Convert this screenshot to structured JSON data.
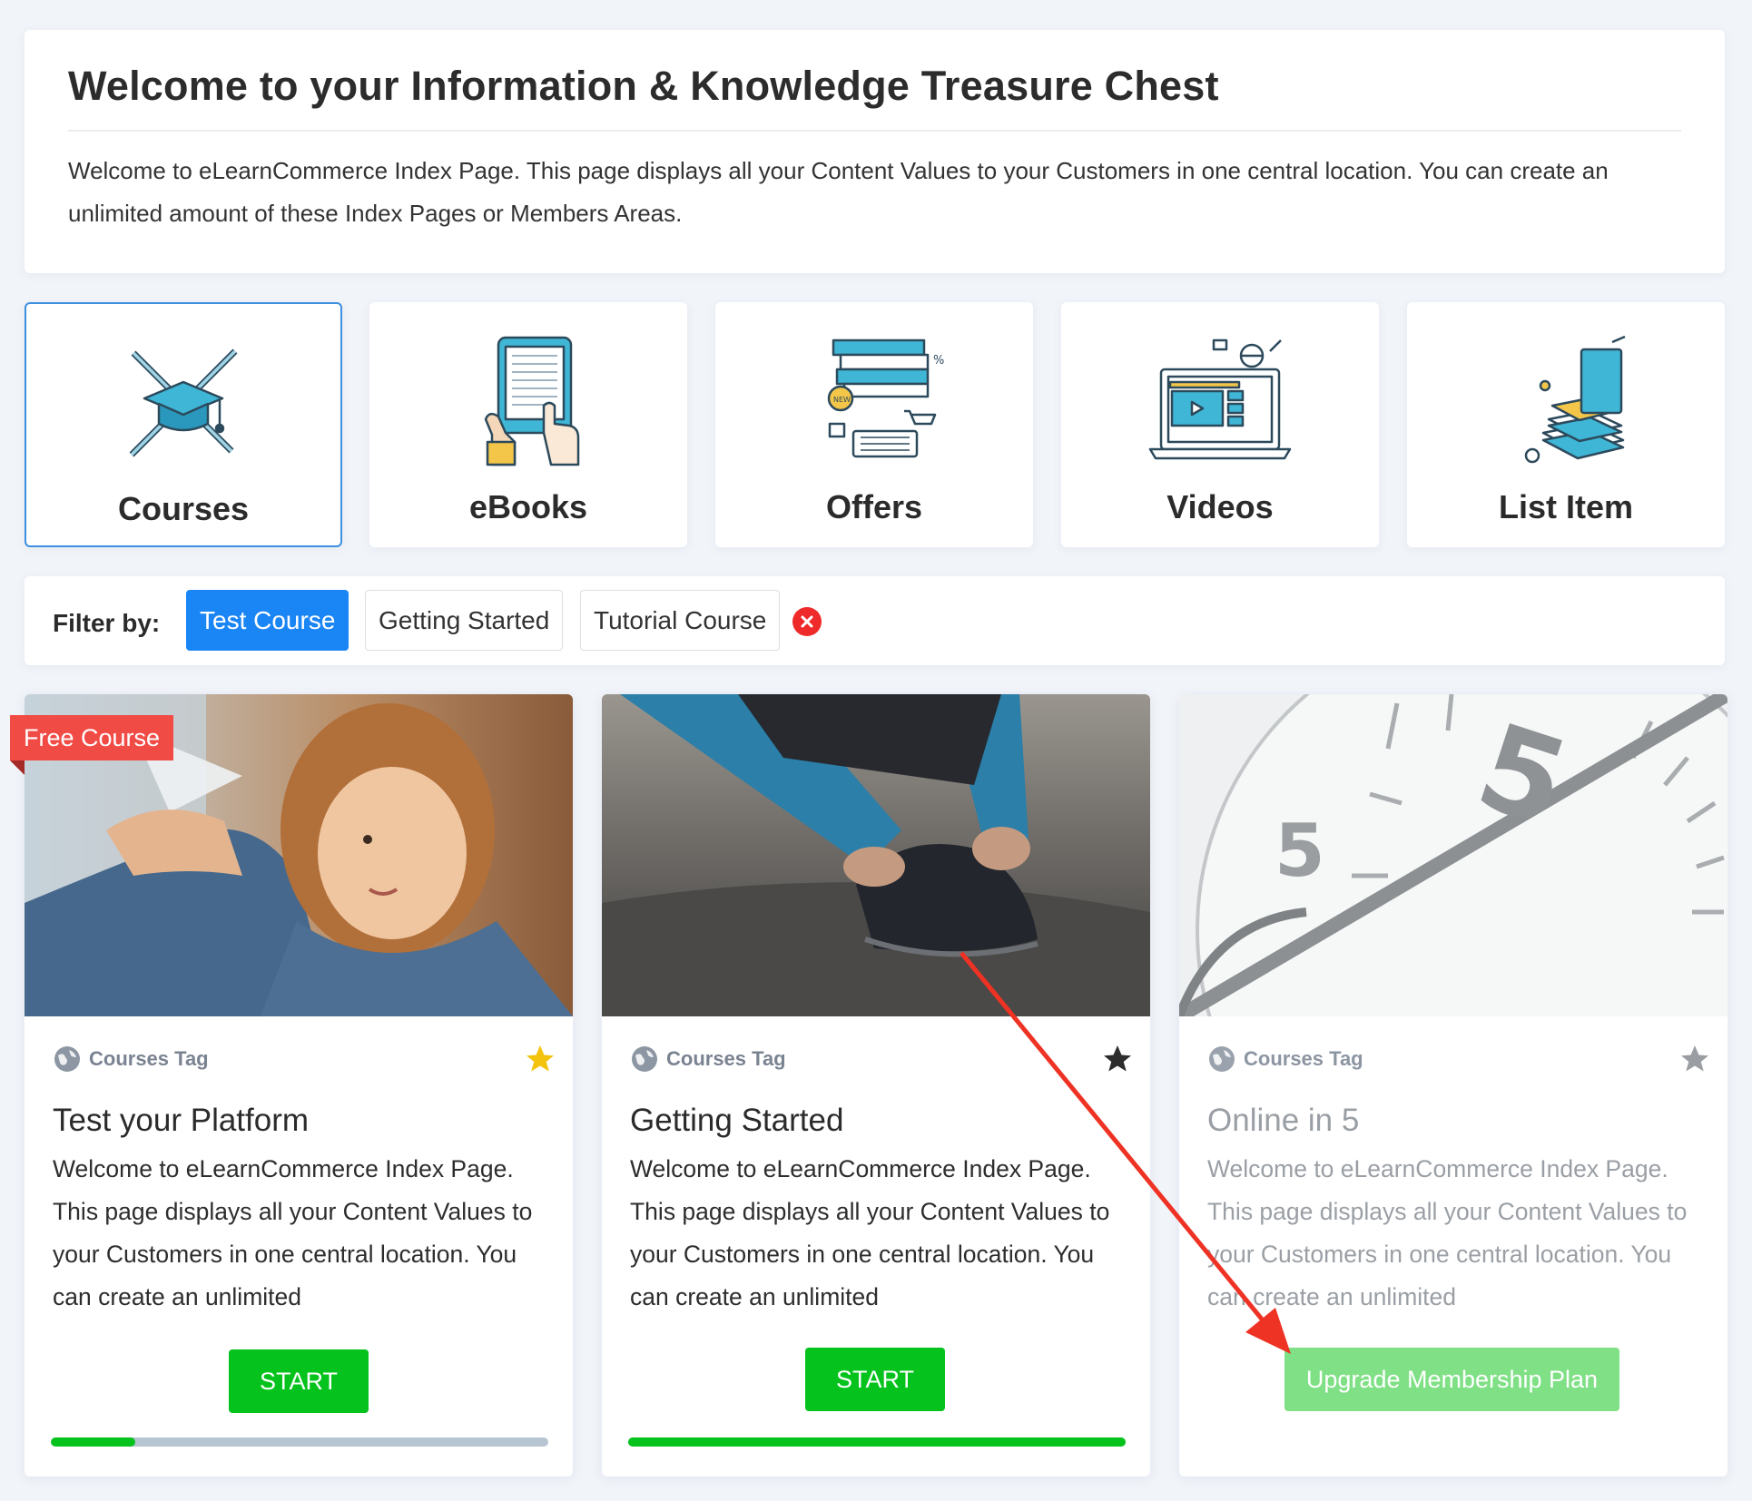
{
  "welcome": {
    "title": "Welcome to your Information & Knowledge Treasure Chest",
    "text": "Welcome to eLearnCommerce Index Page. This page displays all your Content Values to your Customers in one central location. You can create an unlimited amount of these Index Pages or Members Areas."
  },
  "categories": [
    {
      "label": "Courses",
      "icon": "graduation-cap-icon",
      "active": true
    },
    {
      "label": "eBooks",
      "icon": "tablet-ebook-icon",
      "active": false
    },
    {
      "label": "Offers",
      "icon": "books-cart-icon",
      "active": false
    },
    {
      "label": "Videos",
      "icon": "laptop-video-icon",
      "active": false
    },
    {
      "label": "List Item",
      "icon": "book-stack-icon",
      "active": false
    }
  ],
  "filter": {
    "label": "Filter by:",
    "chips": [
      "Test Course",
      "Getting Started",
      "Tutorial Course"
    ],
    "active_chip": "Test Course"
  },
  "cards": [
    {
      "ribbon": "Free Course",
      "tag": "Courses Tag",
      "title": "Test your Platform",
      "description": "Welcome to eLearnCommerce Index Page. This page displays all your Content Values to your Customers in one central location. You can create an unlimited",
      "button": "START",
      "favorite": "gold",
      "progress": 0.17,
      "locked": false
    },
    {
      "tag": "Courses Tag",
      "title": "Getting Started",
      "description": "Welcome to eLearnCommerce Index Page. This page displays all your Content Values to your Customers in one central location. You can create an unlimited",
      "button": "START",
      "favorite": "dark",
      "progress": 1.0,
      "locked": false
    },
    {
      "tag": "Courses Tag",
      "title": "Online in 5",
      "description": "Welcome to eLearnCommerce Index Page. This page displays all your Content Values to your Customers in one central location. You can create an unlimited",
      "button": "Upgrade Membership Plan",
      "favorite": "grey",
      "locked": true
    }
  ],
  "colors": {
    "accent": "#1a85f5",
    "start_button": "#05c21c",
    "ribbon": "#f14b45",
    "annotation_arrow": "#ee3224"
  }
}
